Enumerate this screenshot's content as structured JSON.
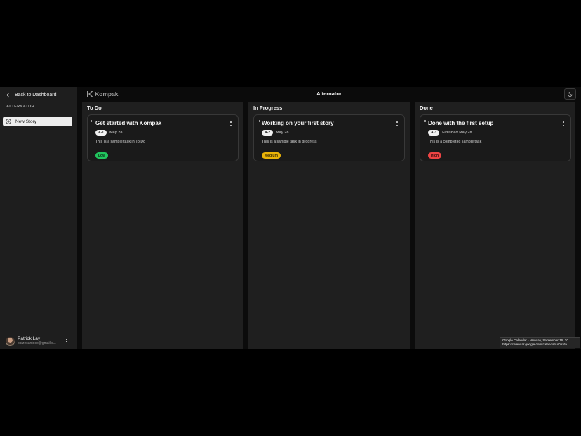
{
  "sidebar": {
    "back_label": "Back to Dashboard",
    "section_label": "ALTERNATOR",
    "new_story_label": "New Story",
    "user": {
      "name": "Patrick Lay",
      "email": "patzesantoso@gmail.c..."
    }
  },
  "header": {
    "logo_text": "Kompak",
    "board_title": "Alternator",
    "theme_icon": "moon-icon"
  },
  "columns": [
    {
      "title": "To Do",
      "card": {
        "title": "Get started with Kompak",
        "key": "A-1",
        "date": "May 28",
        "description": "This is a sample task in To Do",
        "priority": "Low"
      }
    },
    {
      "title": "In Progress",
      "card": {
        "title": "Working on your first story",
        "key": "A-2",
        "date": "May 28",
        "description": "This is a sample task in progress",
        "priority": "Medium"
      }
    },
    {
      "title": "Done",
      "card": {
        "title": "Done with the first setup",
        "key": "A-3",
        "date": "Finished May 28",
        "description": "This is a completed sample task",
        "priority": "High"
      }
    }
  ],
  "tooltip": {
    "line1": "Google Calendar - Monday, September 16, 20...",
    "line2": "https://calendar.google.com/calendar/u/0/r/da..."
  },
  "colors": {
    "priority_low": "#22c55e",
    "priority_medium": "#eab308",
    "priority_high": "#ef4444",
    "column_bg": "#1f1f1f",
    "sidebar_bg": "#1e1e1e"
  }
}
